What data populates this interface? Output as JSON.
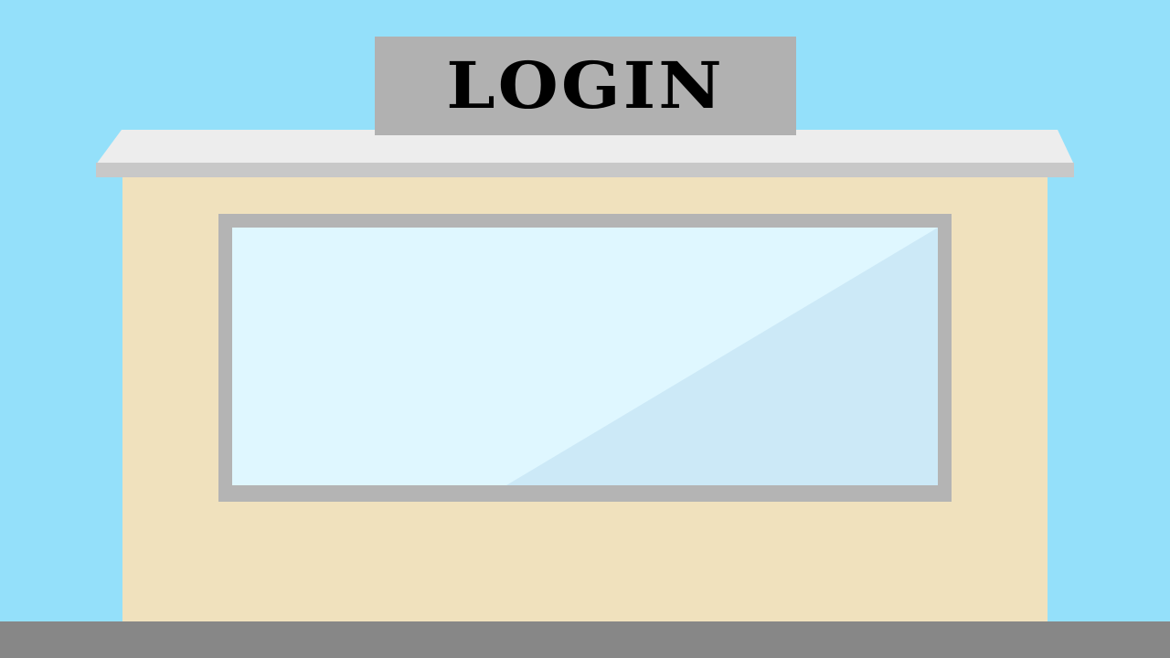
{
  "sign": {
    "label": "LOGIN"
  },
  "colors": {
    "sky": "#94e0fa",
    "building": "#f0e1bd",
    "roof_top": "#ededed",
    "roof_edge": "#c8c8c8",
    "sign_board": "#b1b1b1",
    "sign_text": "#000000",
    "window_frame": "#b4b4b4",
    "window_glass": "#dff7ff",
    "window_glass_shade": "#cce9f7",
    "ground": "#878787"
  }
}
